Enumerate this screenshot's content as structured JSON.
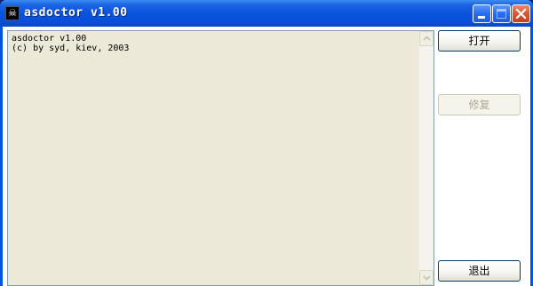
{
  "window": {
    "title": "asdoctor v1.00",
    "icon": "pirate-skull-icon"
  },
  "titlebar_buttons": {
    "minimize": "minimize-icon",
    "maximize": "maximize-icon",
    "close": "close-icon"
  },
  "output": {
    "text": "asdoctor v1.00\n(c) by syd, kiev, 2003"
  },
  "buttons": {
    "open_label": "打开",
    "repair_label": "修复",
    "repair_enabled": false,
    "exit_label": "退出"
  },
  "colors": {
    "titlebar": "#0054E3",
    "close_button": "#D85A38",
    "textarea_bg": "#ECE9D8"
  }
}
